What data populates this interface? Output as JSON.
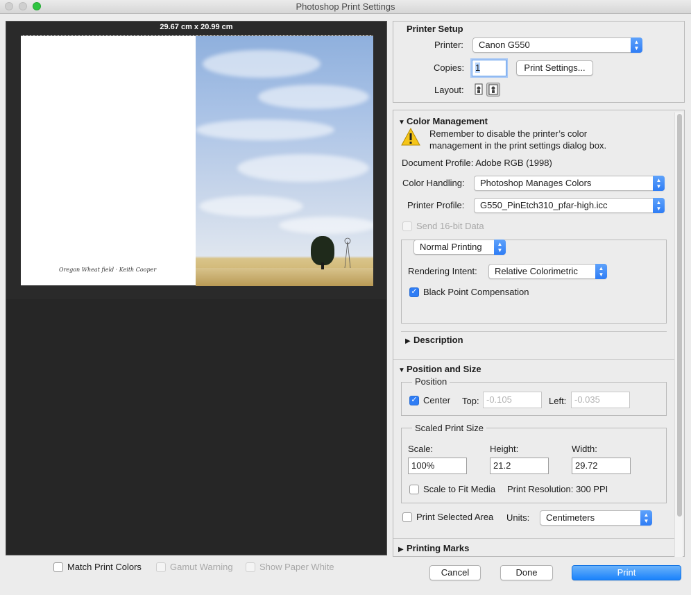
{
  "window": {
    "title": "Photoshop Print Settings"
  },
  "preview": {
    "dimensions": "29.67 cm x 20.99 cm",
    "caption": "Oregon Wheat field · Keith Cooper",
    "match_print_colors": {
      "label": "Match Print Colors",
      "checked": false
    },
    "gamut_warning": {
      "label": "Gamut Warning",
      "checked": false,
      "enabled": false
    },
    "show_paper_white": {
      "label": "Show Paper White",
      "checked": false,
      "enabled": false
    }
  },
  "printer_setup": {
    "heading": "Printer Setup",
    "printer_label": "Printer:",
    "printer_value": "Canon G550",
    "copies_label": "Copies:",
    "copies_value": "1",
    "print_settings_button": "Print Settings...",
    "layout_label": "Layout:",
    "layout_icons": [
      "portrait-layout-icon",
      "landscape-layout-icon"
    ]
  },
  "color_management": {
    "heading": "Color Management",
    "warning_line1": "Remember to disable the printer’s color",
    "warning_line2": "management in the print settings dialog box.",
    "document_profile": "Document Profile: Adobe RGB (1998)",
    "color_handling_label": "Color Handling:",
    "color_handling_value": "Photoshop Manages Colors",
    "printer_profile_label": "Printer Profile:",
    "printer_profile_value": "G550_PinEtch310_pfar-high.icc",
    "send_16bit_label": "Send 16-bit Data",
    "normal_printing_value": "Normal Printing",
    "rendering_intent_label": "Rendering Intent:",
    "rendering_intent_value": "Relative Colorimetric",
    "black_point_label": "Black Point Compensation",
    "black_point_checked": true
  },
  "description": {
    "heading": "Description"
  },
  "position_size": {
    "heading": "Position and Size",
    "position_group": "Position",
    "center_label": "Center",
    "center_checked": true,
    "top_label": "Top:",
    "top_value": "-0.105",
    "left_label": "Left:",
    "left_value": "-0.035",
    "scaled_group": "Scaled Print Size",
    "scale_label": "Scale:",
    "scale_value": "100%",
    "height_label": "Height:",
    "height_value": "21.2",
    "width_label": "Width:",
    "width_value": "29.72",
    "scale_to_fit_label": "Scale to Fit Media",
    "print_resolution": "Print Resolution: 300 PPI",
    "print_selected_label": "Print Selected Area",
    "units_label": "Units:",
    "units_value": "Centimeters"
  },
  "printing_marks": {
    "heading": "Printing Marks"
  },
  "footer": {
    "cancel": "Cancel",
    "done": "Done",
    "print": "Print"
  },
  "colors": {
    "accent": "#2f7df5",
    "preview_bg": "#262626"
  }
}
